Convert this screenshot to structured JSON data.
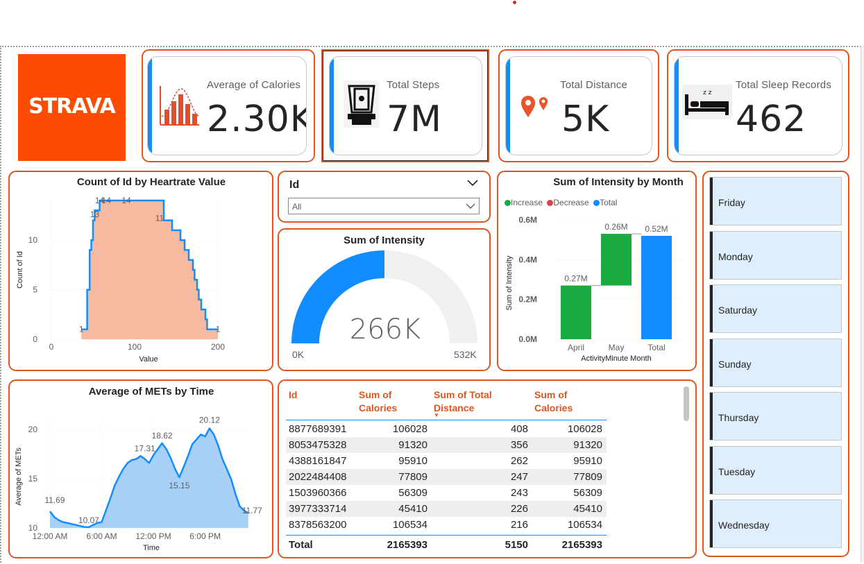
{
  "logo": {
    "text": "STRAVA",
    "color": "#fc4c02"
  },
  "kpis": [
    {
      "label": "Average of Calories",
      "value": "2.30K",
      "icon": "bell-curve-chart-icon"
    },
    {
      "label": "Total Steps",
      "value": "7M",
      "icon": "pedometer-icon"
    },
    {
      "label": "Total Distance",
      "value": "5K",
      "icon": "map-pins-icon"
    },
    {
      "label": "Total Sleep Records",
      "value": "462",
      "icon": "bed-icon"
    }
  ],
  "heartrate_chart": {
    "title": "Count of Id by Heartrate Value",
    "chart_data": {
      "type": "area",
      "title": "Count of Id by Heartrate Value",
      "xlabel": "Value",
      "ylabel": "Count of Id",
      "xlim": [
        0,
        200
      ],
      "ylim": [
        0,
        14
      ],
      "x_ticks": [
        "0",
        "100",
        "200"
      ],
      "y_ticks": [
        "0",
        "5",
        "10"
      ],
      "x": [
        36,
        37,
        40,
        43,
        46,
        48,
        50,
        52,
        55,
        58,
        60,
        63,
        66,
        70,
        75,
        85,
        95,
        100,
        110,
        120,
        125,
        130,
        135,
        140,
        142,
        145,
        148,
        150,
        155,
        160,
        165,
        170,
        172,
        175,
        177,
        180,
        182,
        185,
        187,
        190,
        193,
        196,
        198,
        200
      ],
      "values": [
        1,
        1,
        1,
        5,
        9,
        10,
        12,
        13,
        13,
        14,
        14,
        14,
        14,
        14,
        14,
        14,
        14,
        14,
        14,
        14,
        14,
        14,
        12,
        12,
        12,
        11,
        11,
        11,
        10,
        9,
        8,
        7,
        6,
        5,
        4,
        3,
        3,
        2,
        1,
        1,
        1,
        1,
        1,
        1
      ],
      "data_labels": [
        "1",
        "14",
        "14",
        "14",
        "13",
        "11",
        "1"
      ],
      "colors": {
        "fill": "#f7b9a0",
        "line": "#118dff"
      }
    }
  },
  "id_slicer": {
    "label": "Id",
    "value": "All"
  },
  "gauge": {
    "title": "Sum of Intensity",
    "value_label": "266K",
    "min_label": "0K",
    "max_label": "532K",
    "chart_data": {
      "type": "gauge",
      "value": 266,
      "min": 0,
      "max": 532,
      "unit": "K"
    },
    "colors": {
      "fill": "#118dff",
      "track": "#f0f0f0"
    }
  },
  "waterfall": {
    "title": "Sum of Intensity by Month",
    "legend": [
      {
        "label": "Increase",
        "color": "#1aab40"
      },
      {
        "label": "Decrease",
        "color": "#d64550"
      },
      {
        "label": "Total",
        "color": "#118dff"
      }
    ],
    "chart_data": {
      "type": "bar",
      "subtype": "waterfall",
      "title": "Sum of Intensity by Month",
      "xlabel": "ActivityMinute Month",
      "ylabel": "Sum of Intensity",
      "ylim": [
        0,
        0.6
      ],
      "y_ticks": [
        "0.0M",
        "0.2M",
        "0.4M",
        "0.6M"
      ],
      "categories": [
        "April",
        "May",
        "Total"
      ],
      "values": [
        0.27,
        0.26,
        0.52
      ],
      "kinds": [
        "increase",
        "increase",
        "total"
      ],
      "data_labels": [
        "0.27M",
        "0.26M",
        "0.52M"
      ]
    }
  },
  "mets_chart": {
    "title": "Average of METs by Time",
    "chart_data": {
      "type": "area",
      "title": "Average of METs by Time",
      "xlabel": "Time",
      "ylabel": "Average of METs",
      "xlim": [
        0,
        23.5
      ],
      "ylim": [
        10,
        21
      ],
      "x_ticks": [
        "12:00 AM",
        "6:00 AM",
        "12:00 PM",
        "6:00 PM"
      ],
      "y_ticks": [
        "10",
        "15",
        "20"
      ],
      "x": [
        0,
        0.5,
        1,
        1.5,
        2,
        2.5,
        3,
        3.5,
        4,
        4.5,
        5,
        5.5,
        6,
        6.5,
        7,
        7.5,
        8,
        8.5,
        9,
        9.5,
        10,
        10.5,
        11,
        11.5,
        12,
        12.5,
        13,
        13.5,
        14,
        14.5,
        15,
        15.5,
        16,
        16.5,
        17,
        17.5,
        18,
        18.5,
        19,
        19.5,
        20,
        20.5,
        21,
        21.5,
        22,
        22.5,
        23
      ],
      "values": [
        11.69,
        11.1,
        10.8,
        10.6,
        10.5,
        10.4,
        10.3,
        10.2,
        10.1,
        10.07,
        10.3,
        10.5,
        10.6,
        11.8,
        13.0,
        14.3,
        15.2,
        16.0,
        16.6,
        16.9,
        17.0,
        17.31,
        17.0,
        16.6,
        17.4,
        18.0,
        18.62,
        18.0,
        17.1,
        16.0,
        15.15,
        16.2,
        17.3,
        18.5,
        19.0,
        19.5,
        19.3,
        20.12,
        19.5,
        18.4,
        17.0,
        16.0,
        15.0,
        13.5,
        12.2,
        11.77,
        11.5
      ],
      "data_labels": [
        "11.69",
        "10.07",
        "17.31",
        "18.62",
        "15.15",
        "20.12",
        "11.77"
      ],
      "colors": {
        "fill": "#a8d0f7",
        "line": "#118dff"
      }
    }
  },
  "table": {
    "headers": [
      "Id",
      "Sum of Calories",
      "Sum of Total Distance",
      "Sum of Calories"
    ],
    "rows": [
      [
        "8877689391",
        "106028",
        "408",
        "106028"
      ],
      [
        "8053475328",
        "91320",
        "356",
        "91320"
      ],
      [
        "4388161847",
        "95910",
        "262",
        "95910"
      ],
      [
        "2022484408",
        "77809",
        "247",
        "77809"
      ],
      [
        "1503960366",
        "56309",
        "243",
        "56309"
      ],
      [
        "3977333714",
        "45410",
        "226",
        "45410"
      ],
      [
        "8378563200",
        "106534",
        "216",
        "106534"
      ]
    ],
    "total": [
      "Total",
      "2165393",
      "5150",
      "2165393"
    ],
    "sort_indicator": "▼"
  },
  "weekday_slicer": [
    "Friday",
    "Monday",
    "Saturday",
    "Sunday",
    "Thursday",
    "Tuesday",
    "Wednesday"
  ],
  "colors": {
    "frame": "#e0551d",
    "accent": "#118dff",
    "header_text": "#e0551d"
  }
}
